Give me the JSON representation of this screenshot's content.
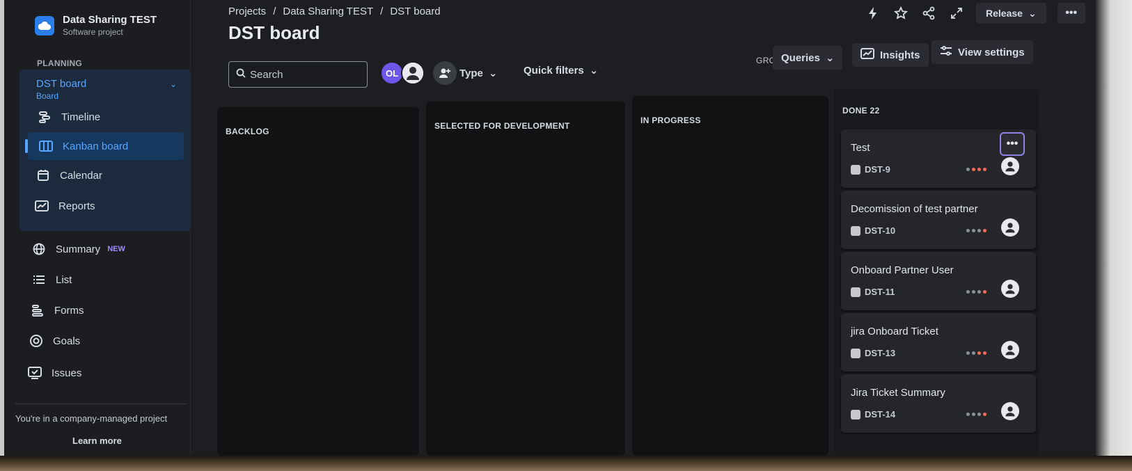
{
  "project": {
    "name": "Data Sharing TEST",
    "type": "Software project"
  },
  "sidebar": {
    "section": "PLANNING",
    "board": {
      "title": "DST board",
      "subtitle": "Board"
    },
    "planning_items": [
      {
        "label": "Timeline",
        "icon": "timeline-icon"
      },
      {
        "label": "Kanban board",
        "icon": "kanban-icon"
      },
      {
        "label": "Calendar",
        "icon": "calendar-icon"
      },
      {
        "label": "Reports",
        "icon": "reports-icon"
      }
    ],
    "items": [
      {
        "label": "Summary",
        "badge": "NEW",
        "icon": "globe-icon"
      },
      {
        "label": "List",
        "icon": "list-icon"
      },
      {
        "label": "Forms",
        "icon": "forms-icon"
      },
      {
        "label": "Goals",
        "icon": "goals-icon"
      },
      {
        "label": "Issues",
        "icon": "issues-icon"
      }
    ],
    "footer": {
      "note": "You're in a company-managed project",
      "link": "Learn more"
    }
  },
  "header": {
    "breadcrumb": [
      "Projects",
      "Data Sharing TEST",
      "DST board"
    ],
    "separator": "/",
    "title": "DST board",
    "release_label": "Release",
    "more_label": "•••"
  },
  "toolbar": {
    "search_placeholder": "Search",
    "avatar_initials": "OL",
    "type_filter": "Type",
    "quick_filters": "Quick filters",
    "group_by_label": "GROUP BY",
    "group_by_value": "Queries",
    "insights": "Insights",
    "view_settings": "View settings"
  },
  "columns": [
    {
      "title": "BACKLOG"
    },
    {
      "title": "SELECTED FOR DEVELOPMENT"
    },
    {
      "title": "IN PROGRESS"
    }
  ],
  "done_column": {
    "title": "DONE 22",
    "cards": [
      {
        "title": "Test",
        "key": "DST-9"
      },
      {
        "title": "Decomission of test partner",
        "key": "DST-10"
      },
      {
        "title": "Onboard Partner User",
        "key": "DST-11"
      },
      {
        "title": "jira Onboard Ticket",
        "key": "DST-13"
      },
      {
        "title": "Jira Ticket Summary",
        "key": "DST-14"
      }
    ],
    "card_more": "•••"
  },
  "colors": {
    "accent": "#58a6ff",
    "avatar": "#6b56e8",
    "priority_high": "#f26d5b",
    "priority_low": "#8a9099"
  }
}
